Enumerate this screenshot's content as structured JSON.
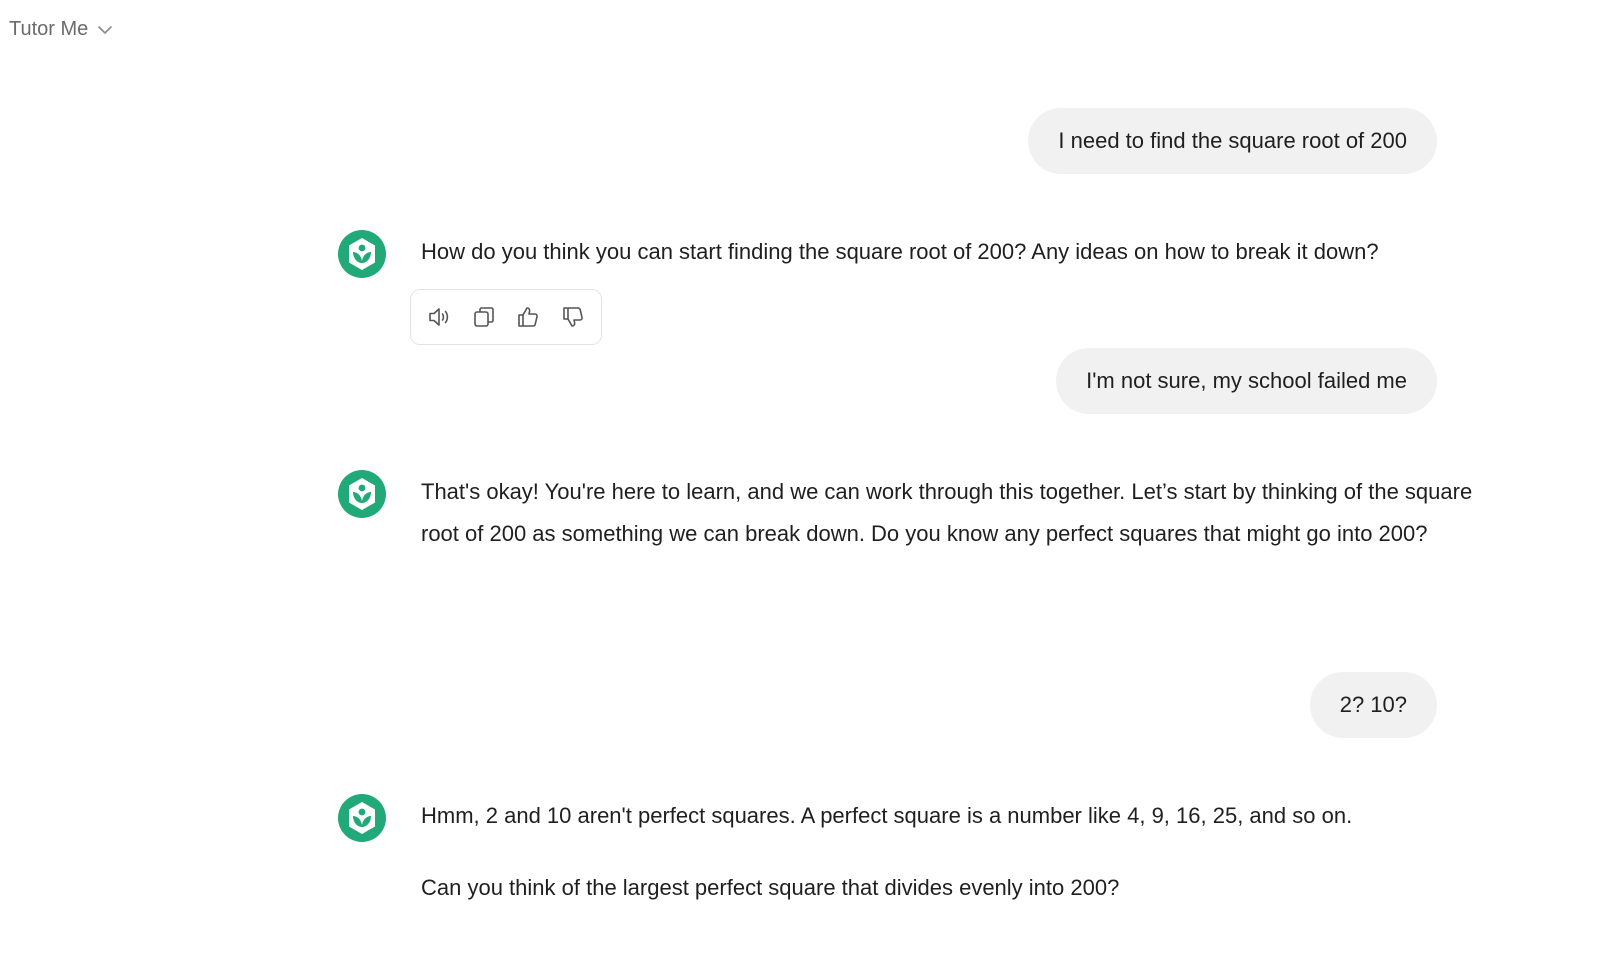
{
  "header": {
    "model_label": "Tutor Me",
    "model_icon": "chevron-down-icon"
  },
  "colors": {
    "accent": "#21a97a",
    "user_bubble": "#f1f1f1",
    "muted_text": "#6b6b6b"
  },
  "messages": [
    {
      "role": "user",
      "text": "I need to find the square root of 200"
    },
    {
      "role": "assistant",
      "paragraphs": [
        "How do you think you can start finding the square root of 200? Any ideas on how to break it down?"
      ]
    },
    {
      "role": "user",
      "text": "I'm not sure, my school failed me"
    },
    {
      "role": "assistant",
      "paragraphs": [
        "That's okay! You're here to learn, and we can work through this together. Let’s start by thinking of the square root of 200 as something we can break down. Do you know any perfect squares that might go into 200?"
      ]
    },
    {
      "role": "user",
      "text": "2? 10?"
    },
    {
      "role": "assistant",
      "paragraphs": [
        "Hmm, 2 and 10 aren't perfect squares. A perfect square is a number like 4, 9, 16, 25, and so on.",
        "Can you think of the largest perfect square that divides evenly into 200?"
      ]
    }
  ],
  "message_actions": {
    "icons": [
      "speaker-icon",
      "copy-icon",
      "thumbs-up-icon",
      "thumbs-down-icon"
    ]
  }
}
